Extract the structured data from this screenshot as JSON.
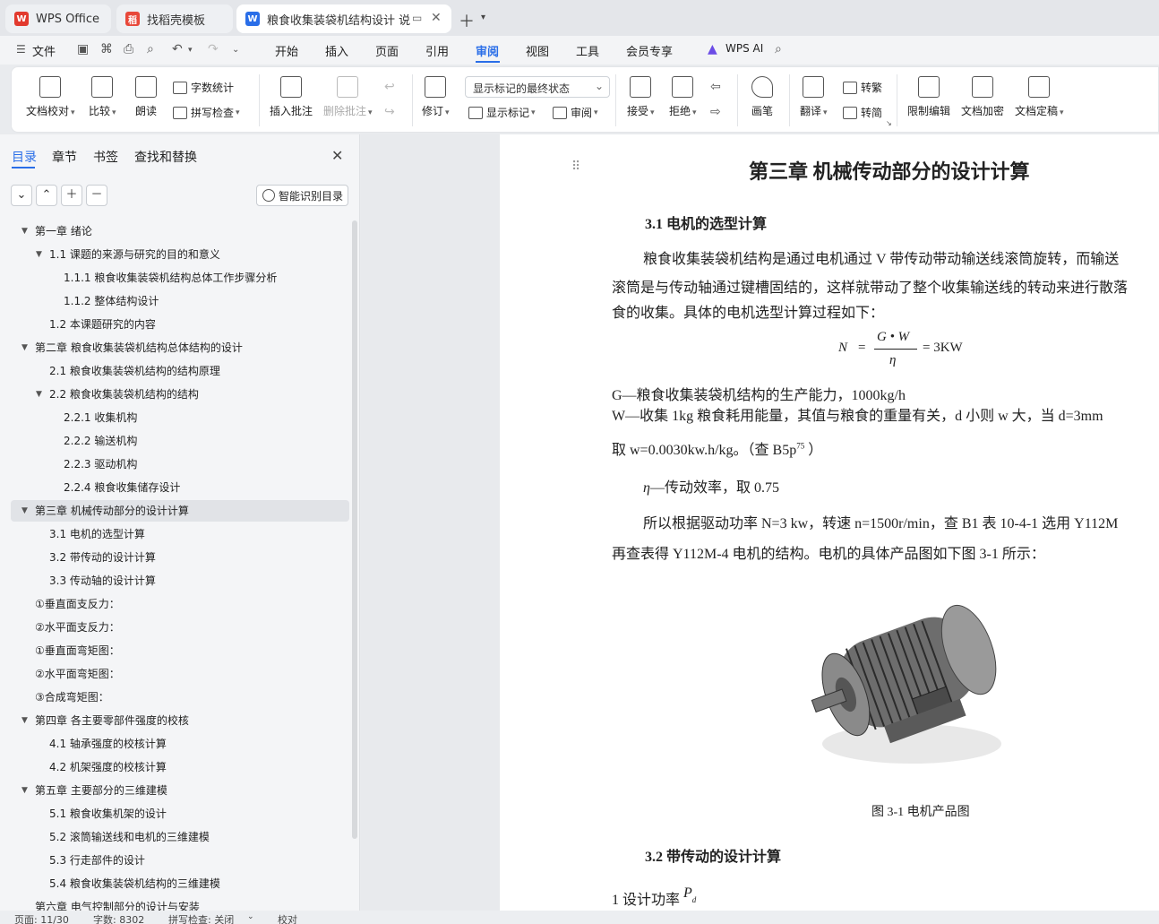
{
  "tabs": [
    {
      "label": "WPS Office",
      "icon": "wps-logo-icon"
    },
    {
      "label": "找稻壳模板",
      "icon": "docer-logo-icon"
    },
    {
      "label": "粮食收集装袋机结构设计 说明",
      "icon": "word-doc-icon"
    }
  ],
  "menu": {
    "file": "文件",
    "items": [
      "开始",
      "插入",
      "页面",
      "引用",
      "审阅",
      "视图",
      "工具",
      "会员专享"
    ],
    "active": "审阅",
    "ai": "WPS AI"
  },
  "ribbon": {
    "doc_proof": "文档校对",
    "compare": "比较",
    "read_aloud": "朗读",
    "word_count": "字数统计",
    "spell_check": "拼写检查",
    "insert_comment": "插入批注",
    "delete_comment": "删除批注",
    "revise": "修订",
    "markup_state": "显示标记的最终状态",
    "show_markup": "显示标记",
    "review_pane": "审阅",
    "accept": "接受",
    "reject": "拒绝",
    "pen": "画笔",
    "translate": "翻译",
    "to_traditional": "转繁",
    "to_simplified": "转简",
    "restrict_edit": "限制编辑",
    "encrypt": "文档加密",
    "finalize": "文档定稿"
  },
  "nav": {
    "tabs": [
      "目录",
      "章节",
      "书签",
      "查找和替换"
    ],
    "smart_toc": "智能识别目录",
    "toc": [
      {
        "text": "第一章  绪论",
        "level": 0,
        "expanded": true
      },
      {
        "text": "1.1  课题的来源与研究的目的和意义",
        "level": 1,
        "expanded": true
      },
      {
        "text": "1.1.1  粮食收集装袋机结构总体工作步骤分析",
        "level": 2
      },
      {
        "text": "1.1.2  整体结构设计",
        "level": 2
      },
      {
        "text": "1.2  本课题研究的内容",
        "level": 1
      },
      {
        "text": "第二章  粮食收集装袋机结构总体结构的设计",
        "level": 0,
        "expanded": true
      },
      {
        "text": "2.1  粮食收集装袋机结构的结构原理",
        "level": 1
      },
      {
        "text": "2.2  粮食收集装袋机结构的结构",
        "level": 1,
        "expanded": true
      },
      {
        "text": "2.2.1    收集机构",
        "level": 2
      },
      {
        "text": "2.2.2    输送机构",
        "level": 2
      },
      {
        "text": "2.2.3  驱动机构",
        "level": 2
      },
      {
        "text": "2.2.4  粮食收集储存设计",
        "level": 2
      },
      {
        "text": "第三章  机械传动部分的设计计算",
        "level": 0,
        "expanded": true,
        "selected": true
      },
      {
        "text": "3.1  电机的选型计算",
        "level": 1
      },
      {
        "text": "3.2  带传动的设计计算",
        "level": 1
      },
      {
        "text": "3.3  传动轴的设计计算",
        "level": 1
      },
      {
        "text": "①垂直面支反力：",
        "level": 0.5
      },
      {
        "text": "②水平面支反力：",
        "level": 0.5
      },
      {
        "text": "①垂直面弯矩图：",
        "level": 0.5
      },
      {
        "text": "②水平面弯矩图：",
        "level": 0.5
      },
      {
        "text": "③合成弯矩图：",
        "level": 0.5
      },
      {
        "text": "第四章  各主要零部件强度的校核",
        "level": 0,
        "expanded": true
      },
      {
        "text": "4.1  轴承强度的校核计算",
        "level": 1
      },
      {
        "text": "4.2  机架强度的校核计算",
        "level": 1
      },
      {
        "text": "第五章  主要部分的三维建模",
        "level": 0,
        "expanded": true
      },
      {
        "text": "5.1  粮食收集机架的设计",
        "level": 1
      },
      {
        "text": "5.2  滚筒输送线和电机的三维建模",
        "level": 1
      },
      {
        "text": "5.3  行走部件的设计",
        "level": 1
      },
      {
        "text": "5.4  粮食收集装袋机结构的三维建模",
        "level": 1
      },
      {
        "text": "第六章  电气控制部分的设计与安装",
        "level": 0
      }
    ]
  },
  "doc": {
    "chapter_title": "第三章  机械传动部分的设计计算",
    "section_31": "3.1   电机的选型计算",
    "para1_line1": "粮食收集装袋机结构是通过电机通过 V 带传动带动输送线滚筒旋转，而输送",
    "para1_line2": "滚筒是与传动轴通过键槽固结的，这样就带动了整个收集输送线的转动来进行散落",
    "para1_line3": "食的收集。具体的电机选型计算过程如下：",
    "formula_lhs": "N",
    "formula_num": "G • W",
    "formula_den": "η",
    "formula_rhs": "= 3KW",
    "g_def": "G—粮食收集装袋机结构的生产能力，1000kg/h",
    "w_def": "W—收集 1kg 粮食耗用能量，其值与粮食的重量有关，d 小则 w 大，当 d=3mm",
    "w_take": "取 w=0.0030kw.h/kg。（查 B5p",
    "w_sup": "75",
    "w_close": " ）",
    "eta_sym": "η",
    "eta_def": "—传动效率，取 0.75",
    "para2_line1": "所以根据驱动功率 N=3 kw，转速 n=1500r/min，查 B1 表 10-4-1 选用 Y112M",
    "para2_line2": "再查表得 Y112M-4 电机的结构。电机的具体产品图如下图 3-1 所示：",
    "figure_caption": "图 3-1  电机产品图",
    "section_32": "3.2   带传动的设计计算",
    "design_power": "1 设计功率",
    "pd_sym": "P",
    "pd_sub": "d"
  },
  "status": {
    "page": "页面: 11/30",
    "words": "字数: 8302",
    "spell": "拼写检查: 关闭",
    "proof": "校对"
  }
}
